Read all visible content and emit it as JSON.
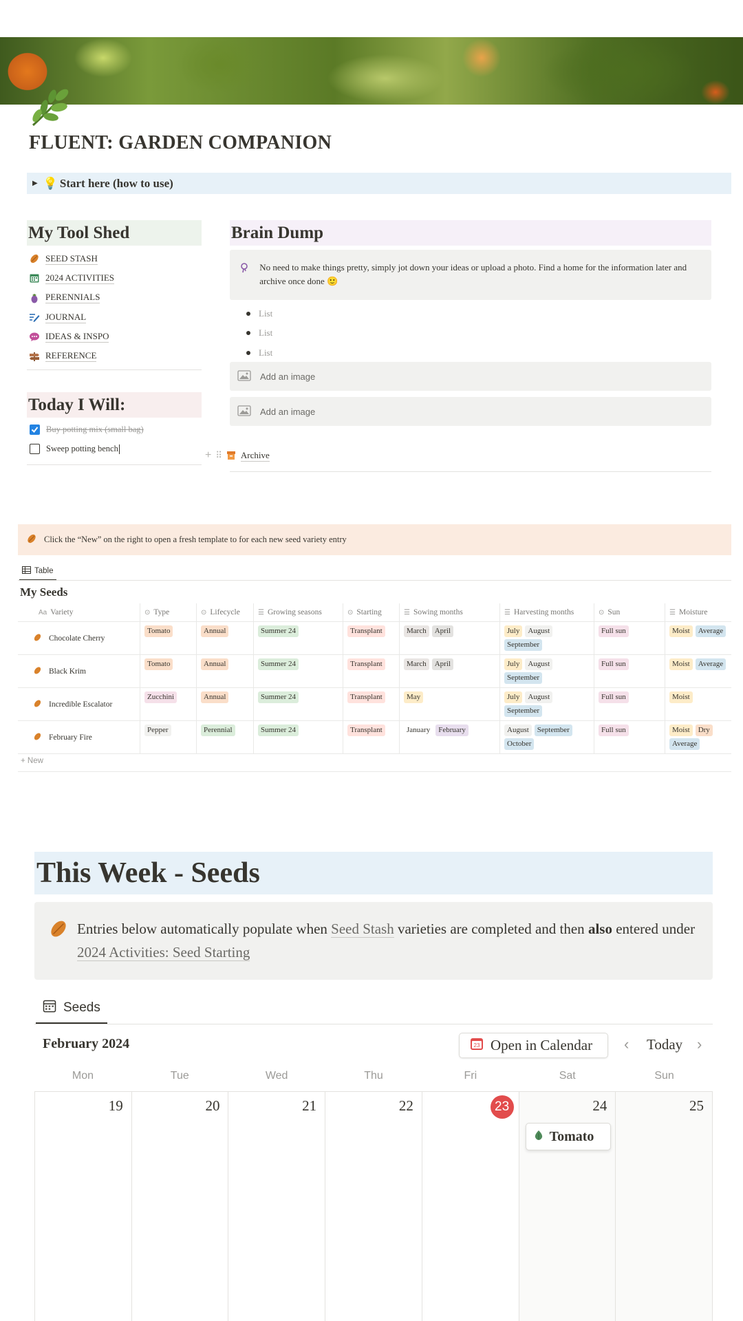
{
  "page": {
    "title": "FLUENT: GARDEN COMPANION",
    "icon": "herb-icon",
    "toggle": {
      "icon": "light-bulb-icon",
      "label": "Start here (how to use)"
    }
  },
  "tool_shed": {
    "heading": "My Tool Shed",
    "items": [
      {
        "icon": "almond-seed-icon",
        "label": "SEED STASH"
      },
      {
        "icon": "calendar-icon",
        "label": "2024 ACTIVITIES"
      },
      {
        "icon": "eggplant-icon",
        "label": "PERENNIALS"
      },
      {
        "icon": "journal-pen-icon",
        "label": "JOURNAL"
      },
      {
        "icon": "idea-bubble-icon",
        "label": "IDEAS & INSPO"
      },
      {
        "icon": "signpost-icon",
        "label": "REFERENCE"
      }
    ]
  },
  "today": {
    "heading": "Today I Will:",
    "todos": [
      {
        "label": "Buy potting mix (small bag)",
        "checked": true
      },
      {
        "label": "Sweep potting bench",
        "checked": false
      }
    ]
  },
  "brain_dump": {
    "heading": "Brain Dump",
    "callout": "No need to make things pretty, simply jot down your ideas or upload a photo. Find a home for the information later and archive once done 🙂",
    "bullets": [
      "List",
      "List",
      "List"
    ],
    "image_placeholders": [
      "Add an image",
      "Add an image"
    ],
    "archive_label": "Archive"
  },
  "seeds_callout": "Click the “New” on the right to open a fresh template to for each new seed variety entry",
  "seeds_view_tab": "Table",
  "seeds_db": {
    "title": "My Seeds",
    "columns": [
      "Variety",
      "Type",
      "Lifecycle",
      "Growing seasons",
      "Starting",
      "Sowing months",
      "Harvesting months",
      "Sun",
      "Moisture"
    ],
    "rows": [
      {
        "variety": "Chocolate Cherry",
        "type": [
          "Tomato"
        ],
        "lifecycle": [
          "Annual"
        ],
        "seasons": [
          "Summer 24"
        ],
        "starting": [
          "Transplant"
        ],
        "sowing": [
          "March",
          "April"
        ],
        "harvesting": [
          "July",
          "August",
          "September"
        ],
        "sun": [
          "Full sun"
        ],
        "moisture": [
          "Moist",
          "Average"
        ]
      },
      {
        "variety": "Black Krim",
        "type": [
          "Tomato"
        ],
        "lifecycle": [
          "Annual"
        ],
        "seasons": [
          "Summer 24"
        ],
        "starting": [
          "Transplant"
        ],
        "sowing": [
          "March",
          "April"
        ],
        "harvesting": [
          "July",
          "August",
          "September"
        ],
        "sun": [
          "Full sun"
        ],
        "moisture": [
          "Moist",
          "Average"
        ]
      },
      {
        "variety": "Incredible Escalator",
        "type": [
          "Zucchini"
        ],
        "lifecycle": [
          "Annual"
        ],
        "seasons": [
          "Summer 24"
        ],
        "starting": [
          "Transplant"
        ],
        "sowing": [
          "May"
        ],
        "harvesting": [
          "July",
          "August",
          "September"
        ],
        "sun": [
          "Full sun"
        ],
        "moisture": [
          "Moist"
        ]
      },
      {
        "variety": "February Fire",
        "type": [
          "Pepper"
        ],
        "lifecycle": [
          "Perennial"
        ],
        "seasons": [
          "Summer 24"
        ],
        "starting": [
          "Transplant"
        ],
        "sowing": [
          "January",
          "February"
        ],
        "harvesting": [
          "August",
          "September",
          "October"
        ],
        "sun": [
          "Full sun"
        ],
        "moisture": [
          "Moist",
          "Dry",
          "Average"
        ]
      }
    ],
    "new_label": "+ New"
  },
  "tag_colors": {
    "Tomato": "#fadec9",
    "Zucchini": "#f5e0e9",
    "Pepper": "#f1f1ef",
    "Annual": "#fadec9",
    "Perennial": "#dbeddb",
    "Summer 24": "#dbeddb",
    "Transplant": "#ffe2dd",
    "March": "#e9e5e3",
    "April": "#e3e2e0",
    "May": "#fdecc8",
    "January": "#ffffff",
    "February": "#e8deee",
    "July": "#fdecc8",
    "August": "#f1f1ef",
    "September": "#d3e5ef",
    "October": "#d3e5ef",
    "Full sun": "#f5e0e9",
    "Moist": "#fdecc8",
    "Average": "#d3e5ef",
    "Dry": "#fadec9"
  },
  "this_week": {
    "heading": "This Week - Seeds",
    "callout": {
      "part1": "Entries below automatically populate when ",
      "link1": "Seed Stash",
      "part2": " varieties are completed and then ",
      "bold": "also",
      "part3": " entered under ",
      "link2": "2024 Activities: Seed Starting"
    },
    "view_tab": "Seeds",
    "month": "February 2024",
    "open_calendar": "Open in Calendar",
    "today_label": "Today",
    "weekdays": [
      "Mon",
      "Tue",
      "Wed",
      "Thu",
      "Fri",
      "Sat",
      "Sun"
    ],
    "days": [
      "19",
      "20",
      "21",
      "22",
      "23",
      "24",
      "25"
    ],
    "today_day": "23",
    "event": {
      "day": "24",
      "label": "Tomato",
      "icon": "seedling-drop-icon"
    }
  }
}
